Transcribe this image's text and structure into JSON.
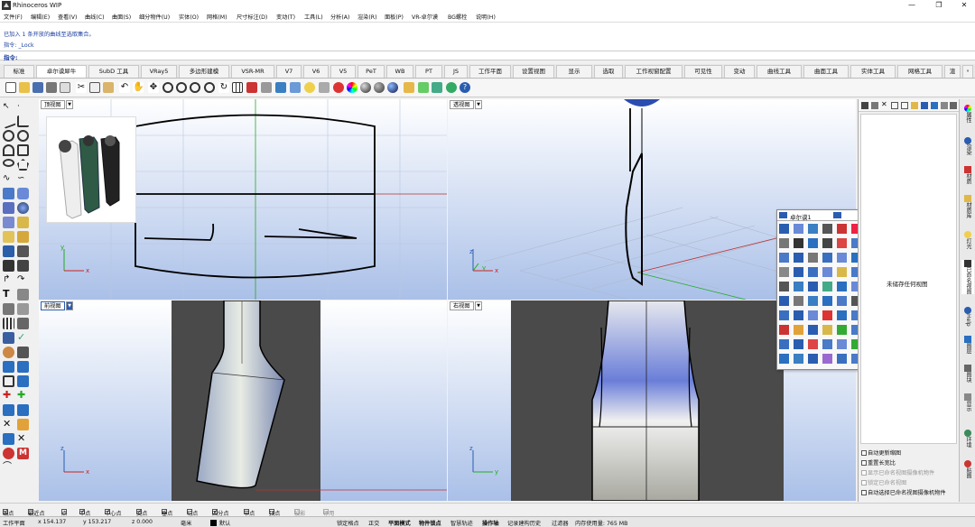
{
  "window": {
    "title": "Rhinoceros WIP",
    "minimize": "—",
    "maximize": "❐",
    "close": "✕"
  },
  "menu": [
    "文件(F)",
    "编辑(E)",
    "查看(V)",
    "曲线(C)",
    "曲面(S)",
    "细分物件(U)",
    "实体(O)",
    "网格(M)",
    "尺寸标注(D)",
    "变动(T)",
    "工具(L)",
    "分析(A)",
    "渲染(R)",
    "面板(P)",
    "VR-卓尔谟",
    "BG螺栓",
    "说明(H)"
  ],
  "command_history": [
    "已加入 1 条开放的曲线至选取集合。",
    "指令: _Lock"
  ],
  "command_prompt": "指令:",
  "tabs": [
    "标准",
    "卓尔谟犀牛",
    "SubD 工具",
    "VRay5",
    "多边形建模",
    "VSR-MR",
    "V7",
    "V6",
    "V5",
    "PeT",
    "WB",
    "PT",
    "JS",
    "工作平面",
    "设置视图",
    "显示",
    "选取",
    "工作视窗配置",
    "可见性",
    "变动",
    "曲线工具",
    "曲面工具",
    "实体工具",
    "网格工具",
    "渲"
  ],
  "viewports": {
    "top": {
      "title": "顶视图"
    },
    "perspective": {
      "title": "透视图"
    },
    "front": {
      "title": "前视图"
    },
    "right": {
      "title": "右视图"
    }
  },
  "axes": {
    "x": "x",
    "y": "y",
    "z": "z"
  },
  "floating_palette": {
    "title": "卓尔谟1",
    "close": "×"
  },
  "right_panel": {
    "empty_text": "未储存任何视图",
    "options": [
      {
        "label": "自动更新缩图",
        "checked": false,
        "enabled": true
      },
      {
        "label": "重置长宽比",
        "checked": false,
        "enabled": true
      },
      {
        "label": "显示已命名视图摄像机物件",
        "checked": false,
        "enabled": false
      },
      {
        "label": "锁定已命名视图",
        "checked": false,
        "enabled": false
      },
      {
        "label": "自动选择已命名视图摄像机物件",
        "checked": false,
        "enabled": true
      }
    ]
  },
  "right_strip": [
    "属性",
    "渲染",
    "材质",
    "材质库",
    "灯光",
    "已命名视图",
    "Help",
    "图层",
    "图块",
    "显示",
    "环境",
    "贴图"
  ],
  "osnap": [
    {
      "label": "端点",
      "checked": true
    },
    {
      "label": "最近点",
      "checked": false
    },
    {
      "label": "点",
      "checked": false
    },
    {
      "label": "中点",
      "checked": true
    },
    {
      "label": "中心点",
      "checked": true
    },
    {
      "label": "交点",
      "checked": true
    },
    {
      "label": "垂点",
      "checked": false
    },
    {
      "label": "切点",
      "checked": false
    },
    {
      "label": "四分点",
      "checked": true
    },
    {
      "label": "节点",
      "checked": false
    },
    {
      "label": "顶点",
      "checked": false
    },
    {
      "label": "投影",
      "checked": false
    },
    {
      "label": "停用",
      "checked": false
    }
  ],
  "status": {
    "cplane": "工作平面",
    "x": "x 154.137",
    "y": "y 153.217",
    "z": "z 0.000",
    "unit": "毫米",
    "layer": "默认",
    "toggles": [
      "锁定格点",
      "正交",
      "平面模式",
      "物件锁点",
      "智慧轨迹",
      "操作轴",
      "记录建构历史",
      "过滤器"
    ],
    "memory": "内存使用量: 765 MB"
  },
  "colors": {
    "viewport_top": "#ffffff",
    "viewport_bottom": "#aac0e8",
    "accent": "#1a3fa0"
  }
}
